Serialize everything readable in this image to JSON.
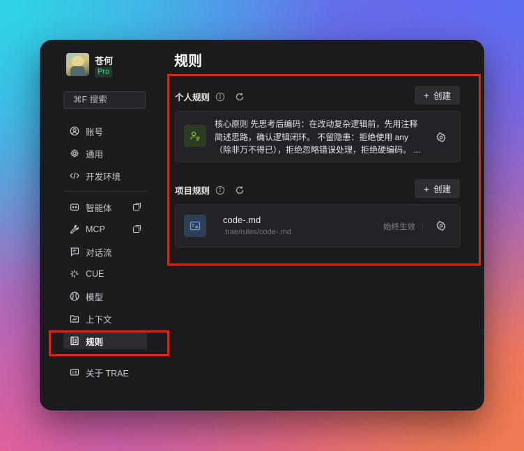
{
  "user": {
    "name": "苍何",
    "badge": "Pro"
  },
  "search": {
    "label": "⌘F 搜索"
  },
  "sidebar": {
    "items": [
      {
        "label": "账号",
        "icon": "account-icon"
      },
      {
        "label": "通用",
        "icon": "gear-icon"
      },
      {
        "label": "开发环境",
        "icon": "code-icon"
      },
      {
        "label": "智能体",
        "icon": "agent-icon",
        "external": true
      },
      {
        "label": "MCP",
        "icon": "wrench-icon",
        "external": true
      },
      {
        "label": "对话流",
        "icon": "chat-flow-icon"
      },
      {
        "label": "CUE",
        "icon": "cue-icon"
      },
      {
        "label": "模型",
        "icon": "model-icon"
      },
      {
        "label": "上下文",
        "icon": "context-icon"
      },
      {
        "label": "规则",
        "icon": "rules-icon",
        "active": true
      },
      {
        "label": "关于 TRAE",
        "icon": "about-icon"
      }
    ]
  },
  "page": {
    "title": "规则"
  },
  "personal_rules": {
    "title": "个人规则",
    "create_label": "创建",
    "rule_text": "核心原则 先思考后编码：在改动复杂逻辑前，先用注释简述思路，确认逻辑闭环。 不留隐患：拒绝使用 any（除非万不得已），拒绝忽略错误处理，拒绝硬编码。 ..."
  },
  "project_rules": {
    "title": "项目规则",
    "create_label": "创建",
    "file_name": "code-.md",
    "file_path": ".trae/rules/code-.md",
    "status": "始终生效"
  },
  "colors": {
    "highlight": "#d42a1e",
    "pro_green": "#4fd17f",
    "window_bg": "#1c1c1f"
  }
}
